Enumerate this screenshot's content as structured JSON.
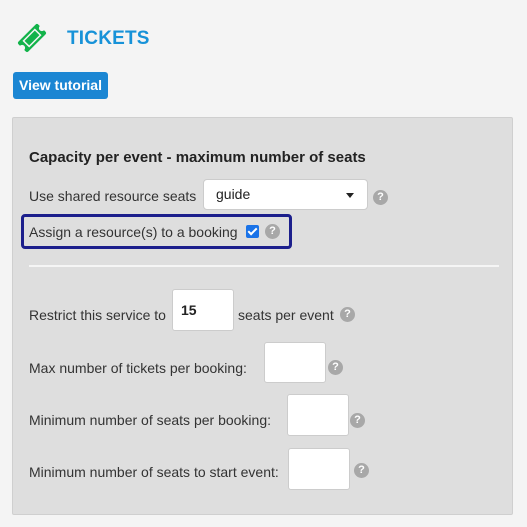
{
  "header": {
    "title": "TICKETS",
    "icon": "ticket-icon",
    "icon_color": "#12b34a",
    "title_color": "#1792d8"
  },
  "tutorial_button": {
    "label": "View tutorial"
  },
  "capacity": {
    "heading": "Capacity per event - maximum number of seats",
    "shared_resource_label": "Use shared resource seats",
    "shared_resource_value": "guide",
    "assign_resource_label": "Assign a resource(s) to a booking",
    "assign_resource_checked": true
  },
  "restrictions": {
    "restrict_prefix": "Restrict this service to",
    "restrict_value": "15",
    "restrict_suffix": "seats per event",
    "max_tickets_label": "Max number of tickets per booking:",
    "max_tickets_value": "",
    "min_seats_booking_label": "Minimum number of seats per booking:",
    "min_seats_booking_value": "",
    "min_seats_start_label": "Minimum number of seats to start event:",
    "min_seats_start_value": ""
  },
  "help_icon_glyph": "?"
}
